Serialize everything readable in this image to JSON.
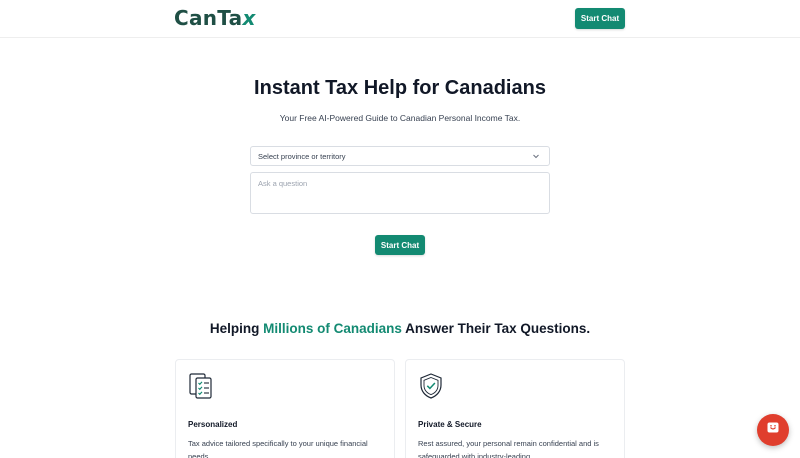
{
  "header": {
    "logo_text": "CanTa",
    "logo_mark": "x",
    "start_chat_label": "Start Chat"
  },
  "hero": {
    "title": "Instant Tax Help for Canadians",
    "subtitle": "Your Free AI-Powered Guide to Canadian Personal Income Tax.",
    "province_select": {
      "selected": "Select province or territory",
      "icon": "chevron-down-icon"
    },
    "question_placeholder": "Ask a question",
    "start_chat_label": "Start Chat"
  },
  "section": {
    "title_before": "Helping ",
    "title_highlight": "Millions of Canadians",
    "title_after": " Answer Their Tax Questions."
  },
  "cards": [
    {
      "icon": "checklist-document-icon",
      "title": "Personalized",
      "description": "Tax advice tailored specifically to your unique financial needs."
    },
    {
      "icon": "shield-check-icon",
      "title": "Private & Secure",
      "description": "Rest assured, your personal remain confidential and is safeguarded with industry-leading"
    }
  ],
  "chat_widget": {
    "icon": "chat-smile-icon"
  },
  "colors": {
    "brand_green": "#138a72",
    "logo_dark": "#1f4f45",
    "chat_fab": "#e03e2d"
  }
}
